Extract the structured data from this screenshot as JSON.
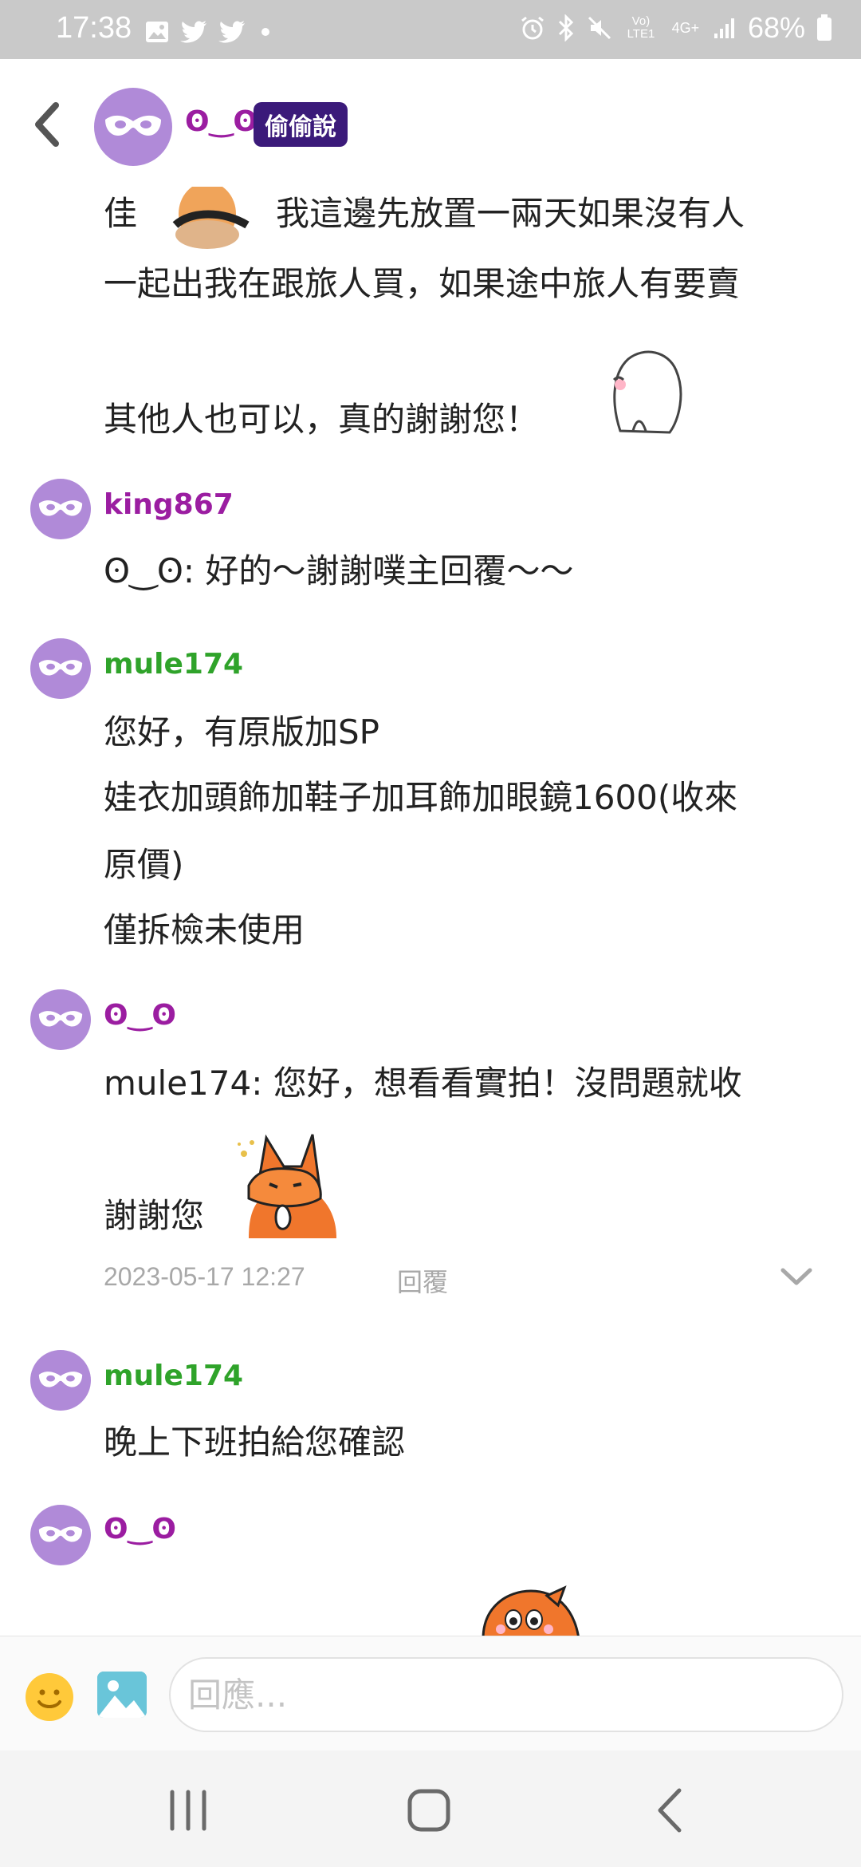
{
  "status_bar": {
    "time": "17:38",
    "network_label": "Vo) LTE1",
    "signal_label": "4G+",
    "battery": "68%"
  },
  "header": {
    "username": "ʘ‿ʘ",
    "badge": "偷偷說"
  },
  "messages": [
    {
      "text_lines": [
        "佳",
        "我這邊先放置一兩天如果沒有人",
        "一起出我在跟旅人買，如果途中旅人有要賣",
        "其他人也可以，真的謝謝您！"
      ]
    },
    {
      "user": "king867",
      "text_lines": [
        "ʘ‿ʘ: 好的～謝謝噗主回覆～～"
      ]
    },
    {
      "user": "mule174",
      "text_lines": [
        "您好，有原版加SP",
        "娃衣加頭飾加鞋子加耳飾加眼鏡1600(收來",
        "原價)",
        "僅拆檢未使用"
      ]
    },
    {
      "user": "ʘ‿ʘ",
      "text_lines": [
        "mule174: 您好，想看看實拍！沒問題就收",
        "謝謝您"
      ],
      "timestamp": "2023-05-17 12:27",
      "reply_label": "回覆"
    },
    {
      "user": "mule174",
      "text_lines": [
        "晚上下班拍給您確認"
      ]
    },
    {
      "user": "ʘ‿ʘ"
    }
  ],
  "input": {
    "placeholder": "回應..."
  },
  "colors": {
    "accent_purple": "#9b1da1",
    "green_user": "#2fa32a",
    "badge_bg": "#3b1a7a",
    "avatar": "#b08ad8"
  }
}
